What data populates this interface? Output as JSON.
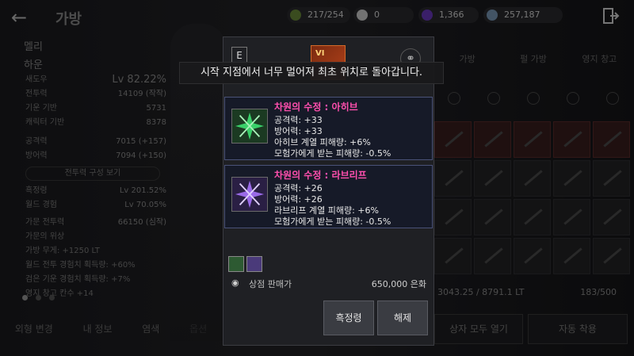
{
  "header": {
    "back_icon": "back-arrow-icon",
    "title": "가방",
    "resources": [
      {
        "icon": "energy-icon",
        "value": "217/254",
        "color": "#8fd05a"
      },
      {
        "icon": "pearl-icon",
        "value": "0",
        "color": "#e8e8e8"
      },
      {
        "icon": "gem-icon",
        "value": "1,366",
        "color": "#8a4de0"
      },
      {
        "icon": "silver-icon",
        "value": "257,187",
        "color": "#9ab8d8"
      }
    ],
    "exit_icon": "exit-door-icon"
  },
  "left_panel": {
    "family": "멜리",
    "name": "하운",
    "rows": [
      {
        "label": "새도우",
        "value": "Lv 82.22%"
      },
      {
        "label": "전투력",
        "value": "14109 (작작)"
      },
      {
        "label": "기운 기반",
        "value": "5731"
      },
      {
        "label": "캐릭터 기반",
        "value": "8378"
      },
      {
        "label": "공격력",
        "value": "7015 (+157)"
      },
      {
        "label": "방어력",
        "value": "7094 (+150)"
      }
    ],
    "combat_btn": "전투력 구성 보기",
    "rows2": [
      {
        "label": "흑정령",
        "value": "Lv 201.52%"
      },
      {
        "label": "월드 경험",
        "value": "Lv 70.05%"
      },
      {
        "label": "가문 전투력",
        "value": "66150 (심작)"
      },
      {
        "label": "가문의 위상",
        "value": ""
      },
      {
        "label": "가방 무게: +1250 LT",
        "value": ""
      },
      {
        "label": "월드 전투 경험치 획득량: +60%",
        "value": ""
      },
      {
        "label": "검은 기운 경험치 획득량: +7%",
        "value": ""
      },
      {
        "label": "영지 창고 칸수 +14",
        "value": ""
      }
    ],
    "bottom_tabs": [
      "외형 변경",
      "내 정보",
      "염색",
      "옵션"
    ]
  },
  "inventory": {
    "tabs": [
      "가방",
      "펄 가방",
      "영지 창고"
    ],
    "capacity": "3043.25 / 8791.1 LT",
    "slots": "183/500",
    "open_all": "상자 모두 열기",
    "auto_equip": "자동 착용"
  },
  "toast": "시작 지점에서 너무 멀어져 최초 위치로 돌아갑니다.",
  "item": {
    "grade": "E",
    "enhance": "VI",
    "link_icon": "link-icon",
    "crystals": [
      {
        "name": "차원의 수정 : 아히브",
        "icon": "green-crystal-icon",
        "color": "#3ad06a",
        "stats": [
          "공격력: +33",
          "방어력: +33",
          "아히브 계열 피해량: +6%",
          "모험가에게 받는 피해량: -0.5%"
        ]
      },
      {
        "name": "차원의 수정 : 라브리프",
        "icon": "purple-crystal-icon",
        "color": "#9a6ae8",
        "stats": [
          "공격력: +26",
          "방어력: +26",
          "라브리프 계열 피해량: +6%",
          "모험가에게 받는 피해량: -0.5%"
        ]
      }
    ],
    "sell_label": "상점 판매가",
    "sell_price": "650,000 은화",
    "btn_left": "흑정령",
    "btn_right": "해제"
  }
}
